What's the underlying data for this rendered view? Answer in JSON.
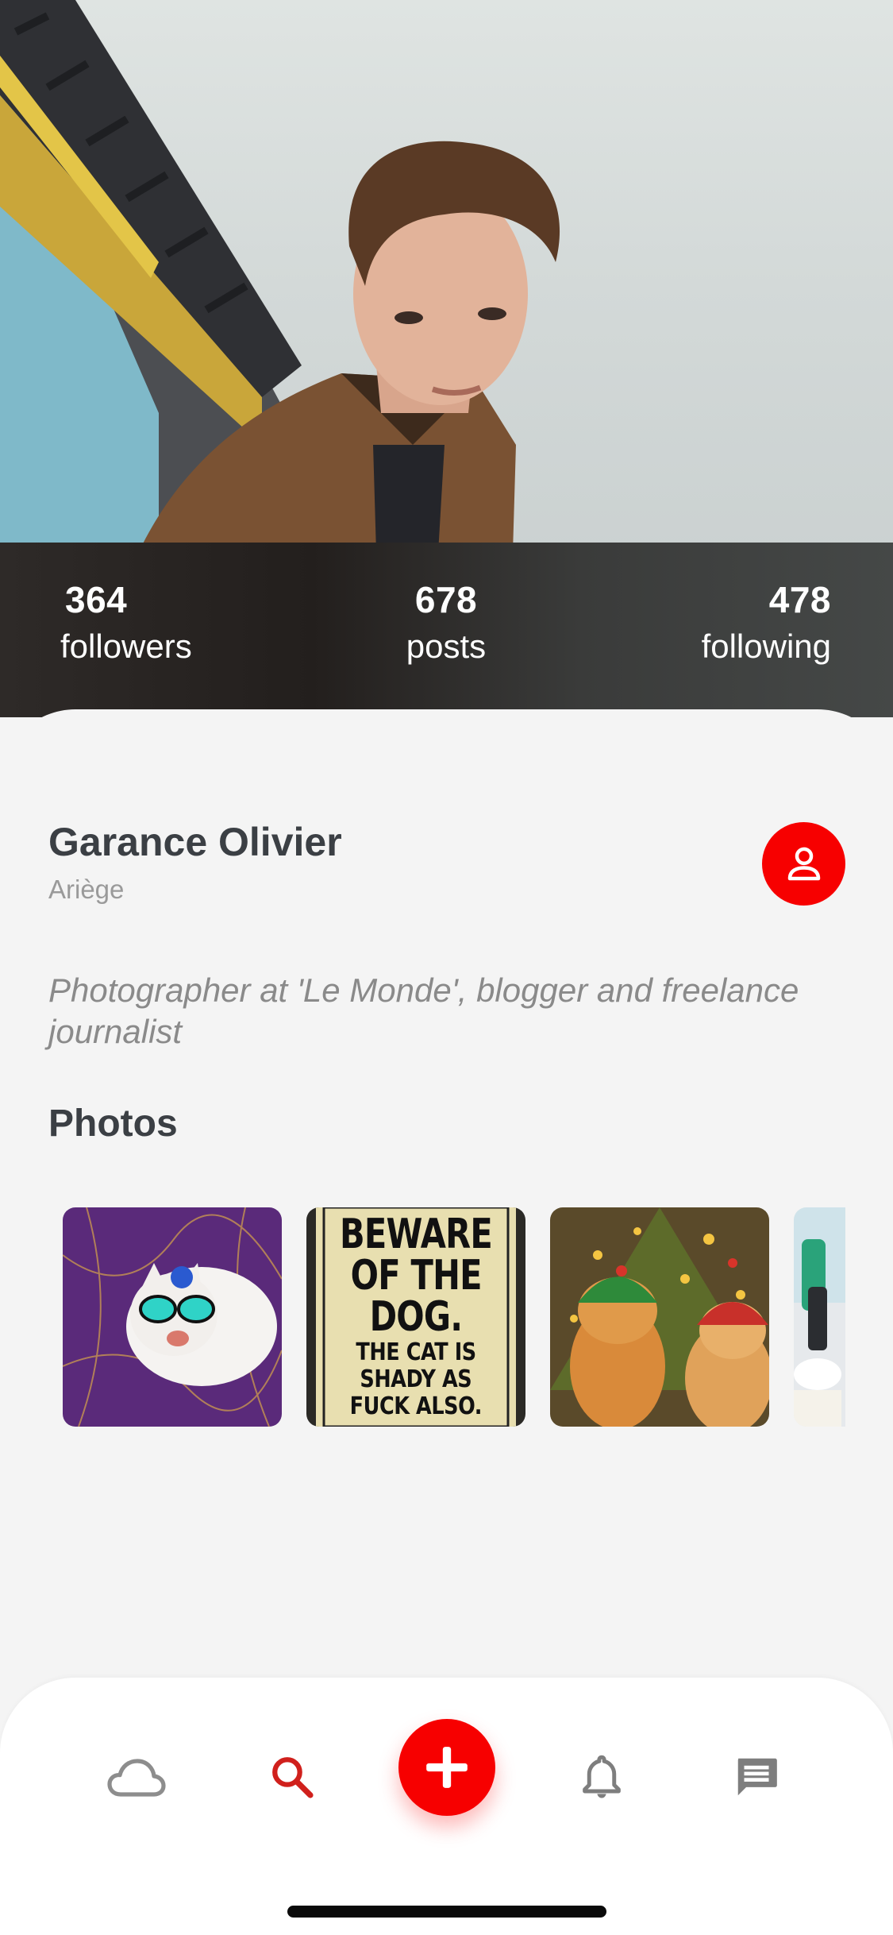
{
  "profile": {
    "name": "Garance Olivier",
    "location": "Ariège",
    "bio": "Photographer at 'Le Monde', blogger and freelance journalist"
  },
  "stats": {
    "followers": {
      "value": "364",
      "label": "followers"
    },
    "posts": {
      "value": "678",
      "label": "posts"
    },
    "following": {
      "value": "478",
      "label": "following"
    }
  },
  "photos": {
    "title": "Photos",
    "items": [
      {
        "icon": "cat-goggles-photo"
      },
      {
        "icon": "beware-sign-photo",
        "lines": [
          "BEWARE",
          "OF THE",
          "DOG.",
          "THE CAT IS",
          "SHADY AS",
          "FUCK ALSO."
        ]
      },
      {
        "icon": "christmas-cats-photo"
      },
      {
        "icon": "bathroom-photo"
      }
    ]
  },
  "nav": {
    "items": [
      "cloud-icon",
      "search-icon",
      "add-icon",
      "bell-icon",
      "chat-icon"
    ],
    "active": "search-icon"
  },
  "colors": {
    "accent": "#f70000",
    "text_dark": "#3b3f44",
    "text_muted": "#9a9a9a"
  }
}
